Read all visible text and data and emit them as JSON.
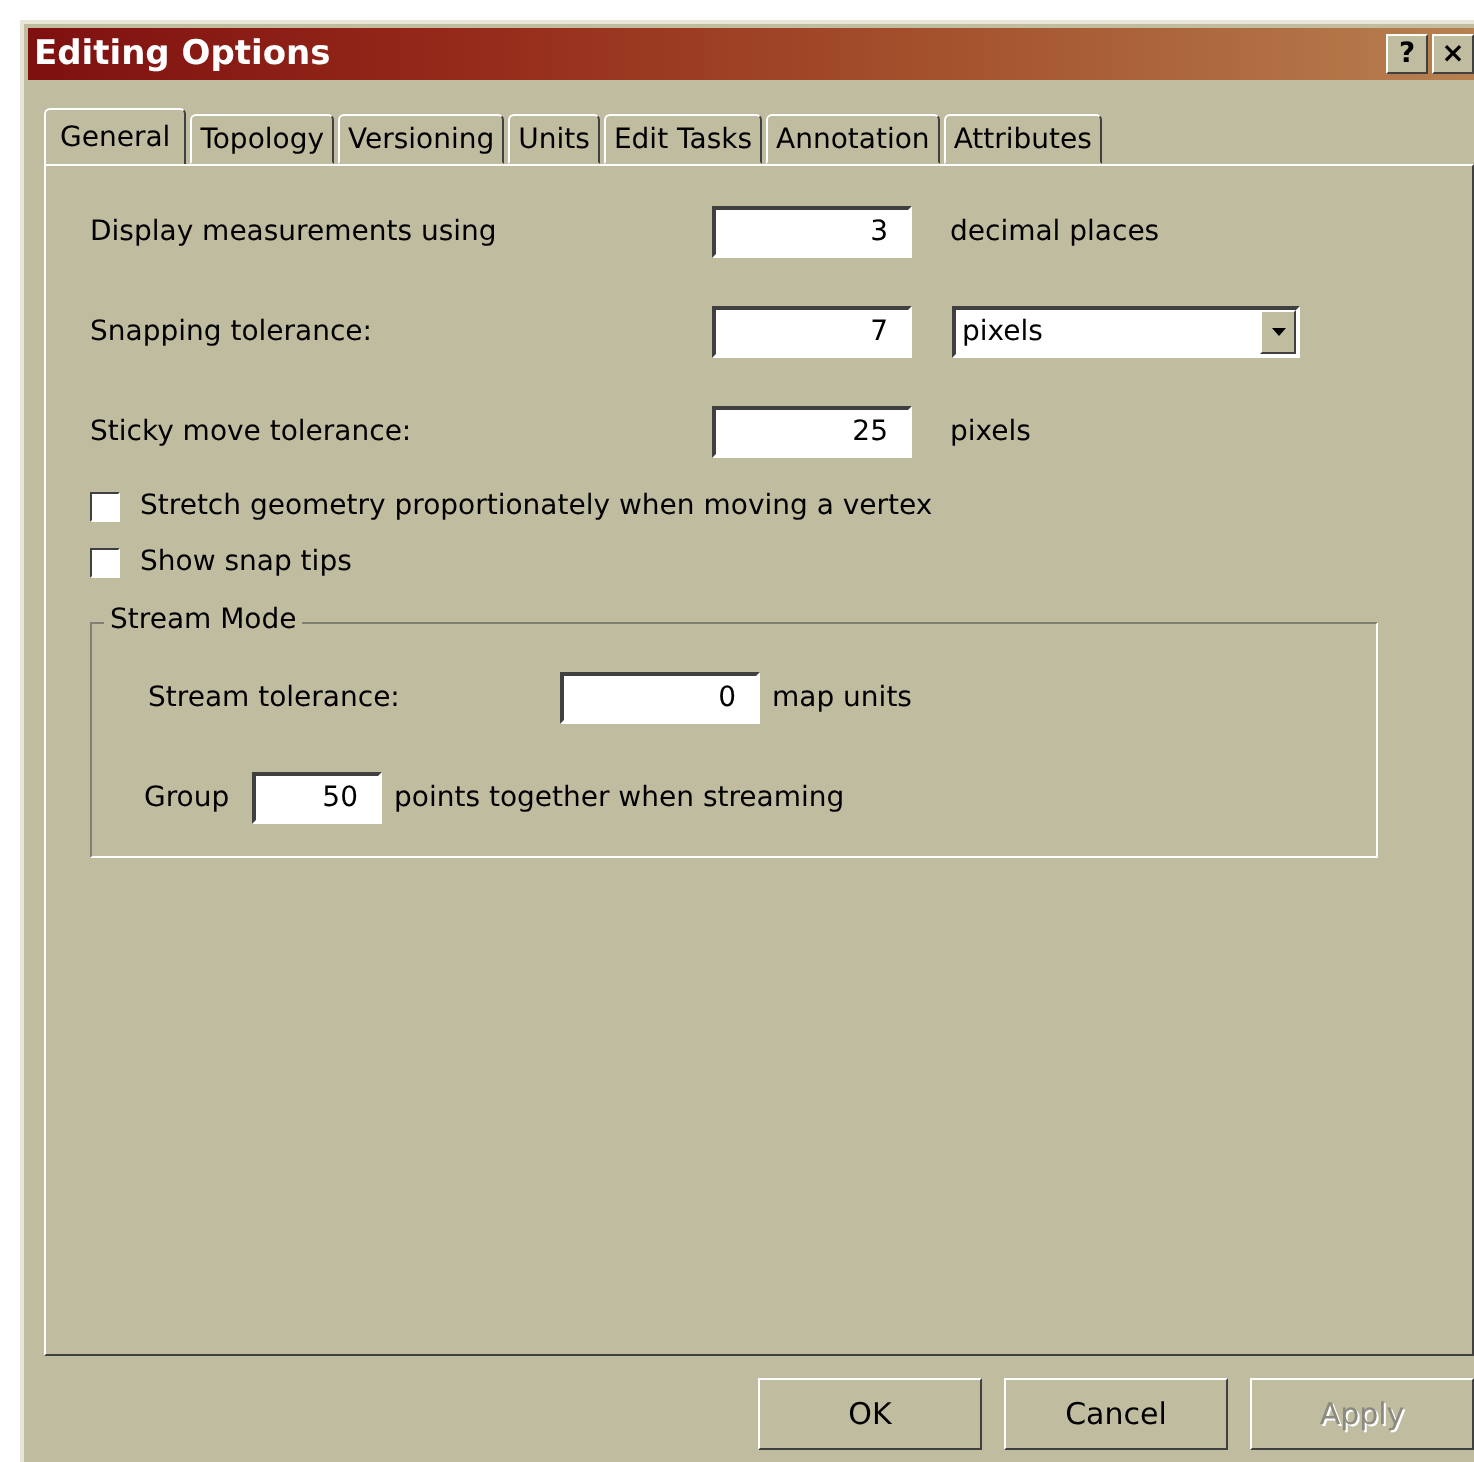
{
  "window": {
    "title": "Editing Options",
    "title_buttons": [
      "?",
      "×"
    ]
  },
  "tabs": [
    {
      "label": "General",
      "selected": true
    },
    {
      "label": "Topology",
      "selected": false
    },
    {
      "label": "Versioning",
      "selected": false
    },
    {
      "label": "Units",
      "selected": false
    },
    {
      "label": "Edit Tasks",
      "selected": false
    },
    {
      "label": "Annotation",
      "selected": false
    },
    {
      "label": "Attributes",
      "selected": false
    }
  ],
  "settings": [
    {
      "kind": "field",
      "label": "Display measurements using",
      "value": "3",
      "suffix": "decimal places"
    },
    {
      "kind": "dropdown",
      "label": "Snapping tolerance:",
      "value": "7",
      "unit": "pixels"
    },
    {
      "kind": "field",
      "label": "Sticky move tolerance:",
      "value": "25",
      "suffix": "pixels"
    }
  ],
  "checkboxes": [
    {
      "label": "Stretch geometry proportionately when moving a vertex",
      "checked": false
    },
    {
      "label": "Show snap tips",
      "checked": false
    }
  ],
  "stream_mode": {
    "title": "Stream Mode",
    "tolerance_label": "Stream tolerance:",
    "tolerance_value": "0",
    "tolerance_unit": "map units",
    "group_label": "Group",
    "group_value": "50",
    "group_suffix": "points together when streaming"
  },
  "buttons": [
    {
      "label": "OK",
      "disabled": false
    },
    {
      "label": "Cancel",
      "disabled": false
    },
    {
      "label": "Apply",
      "disabled": true
    }
  ]
}
